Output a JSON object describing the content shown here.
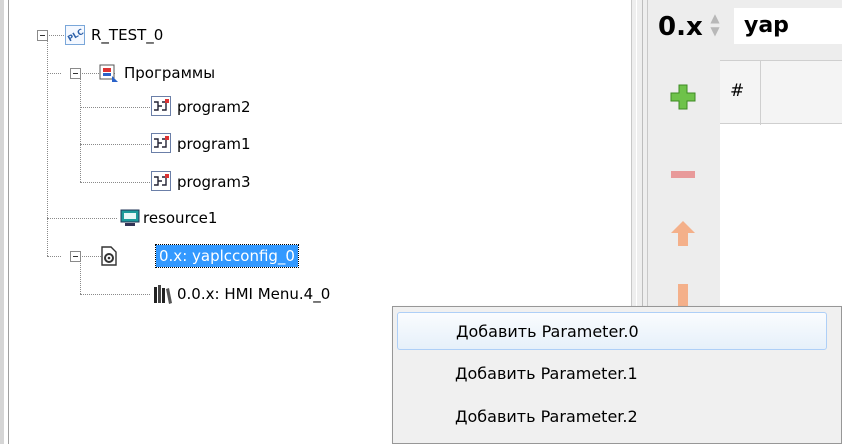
{
  "tree": {
    "nodes": [
      {
        "label": "R_TEST_0",
        "icon": "plc-icon"
      },
      {
        "label": "Программы",
        "icon": "programs-folder-icon"
      },
      {
        "label": "program2",
        "icon": "program-icon"
      },
      {
        "label": "program1",
        "icon": "program-icon"
      },
      {
        "label": "program3",
        "icon": "program-icon"
      },
      {
        "label": "resource1",
        "icon": "resource-icon"
      },
      {
        "label": "0.x: yaplcconfig_0",
        "icon": "config-icon",
        "selected": true
      },
      {
        "label": "0.0.x: HMI Menu.4_0",
        "icon": "library-icon"
      }
    ]
  },
  "editor": {
    "config_id": "0.x",
    "name_value": "yap",
    "grid_header": "#"
  },
  "context_menu": {
    "items": [
      {
        "label": "Добавить Parameter.0",
        "highlighted": true
      },
      {
        "label": "Добавить Parameter.1"
      },
      {
        "label": "Добавить Parameter.2"
      }
    ]
  },
  "colors": {
    "selection": "#3399ff",
    "add_green": "#6ec24a",
    "remove_red": "#e89a9a",
    "arrow_orange": "#f4b08a"
  }
}
